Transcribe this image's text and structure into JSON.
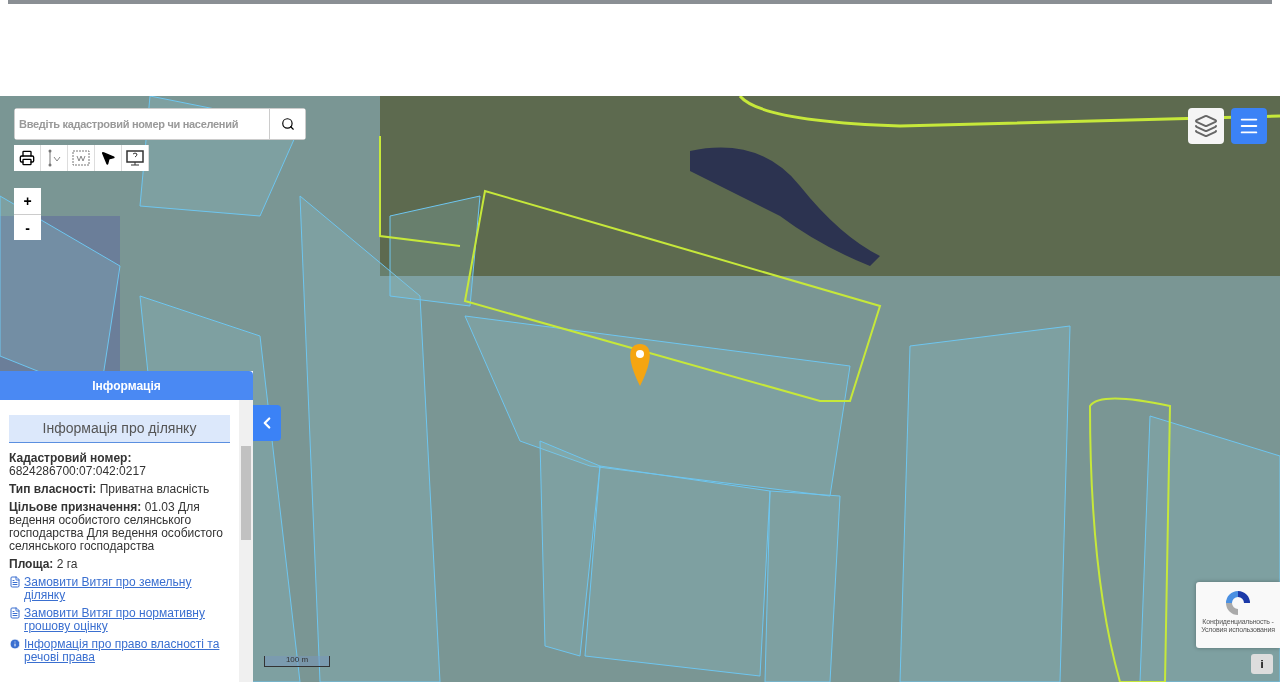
{
  "search": {
    "placeholder": "Введіть кадастровий номер чи населений"
  },
  "zoom": {
    "in": "+",
    "out": "-"
  },
  "info_panel": {
    "title": "Інформація",
    "section_title": "Інформація про ділянку",
    "fields": [
      {
        "label": "Кадастровий номер:",
        "value": "6824286700:07:042:0217"
      },
      {
        "label": "Тип власності:",
        "value": "Приватна власність"
      },
      {
        "label": "Цільове призначення:",
        "value": "01.03 Для ведення особистого селянського господарства Для ведення особистого селянського господарства"
      },
      {
        "label": "Площа:",
        "value": "2 га"
      }
    ],
    "links": [
      {
        "kind": "document",
        "text": "Замовити Витяг про земельну ділянку"
      },
      {
        "kind": "document",
        "text": "Замовити Витяг про нормативну грошову оцінку"
      },
      {
        "kind": "info",
        "text": "Інформація про право власності та речові права"
      }
    ]
  },
  "scale": "100 m",
  "recaptcha": {
    "lines": [
      "Конфиденциальность -",
      "Условия использования"
    ]
  },
  "info_button": "i"
}
